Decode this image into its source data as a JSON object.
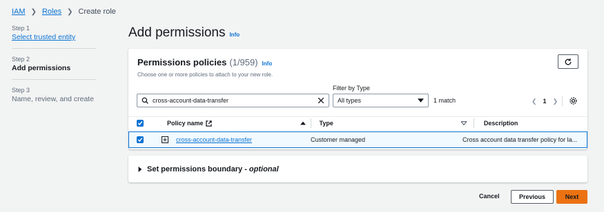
{
  "breadcrumb": {
    "iam": "IAM",
    "roles": "Roles",
    "current": "Create role"
  },
  "steps": [
    {
      "num": "Step 1",
      "name": "Select trusted entity"
    },
    {
      "num": "Step 2",
      "name": "Add permissions"
    },
    {
      "num": "Step 3",
      "name": "Name, review, and create"
    }
  ],
  "page": {
    "title": "Add permissions",
    "info": "Info"
  },
  "panel": {
    "title": "Permissions policies",
    "count": "(1/959)",
    "info": "Info",
    "description": "Choose one or more policies to attach to your new role.",
    "filter_label": "Filter by Type",
    "search_value": "cross-account-data-transfer",
    "select_value": "All types",
    "match": "1 match",
    "page_number": "1"
  },
  "table": {
    "headers": {
      "name": "Policy name",
      "type": "Type",
      "description": "Description"
    },
    "row": {
      "name": "cross-account-data-transfer",
      "type": "Customer managed",
      "description": "Cross account data transfer policy for la..."
    }
  },
  "boundary": {
    "label": "Set permissions boundary - ",
    "optional": "optional"
  },
  "footer": {
    "cancel": "Cancel",
    "previous": "Previous",
    "next": "Next"
  },
  "colors": {
    "link": "#0972d3",
    "primary": "#ec7211",
    "selected_row": "#f1faff"
  }
}
